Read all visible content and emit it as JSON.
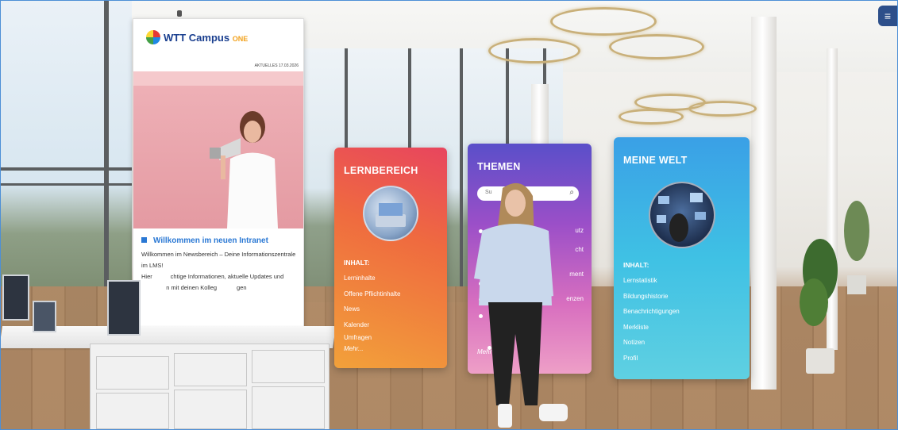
{
  "news_screen": {
    "logo_brand": "WTT Campus",
    "logo_suffix": "ONE",
    "meta": "AKTUELLES   17.03.2026",
    "title": "Willkommen im neuen Intranet",
    "body_lines": [
      "Willkommen im Newsbereich – Deine Informationszentrale",
      "im LMS!",
      "Hier           chtige Informationen, aktuelle Updates und",
      "               n mit deinen Kolleg            gen"
    ]
  },
  "panels": {
    "lernbereich": {
      "title": "LERNBEREICH",
      "content_label": "INHALT:",
      "items": [
        "Lerninhalte",
        "Offene Pflichtinhalte",
        "News",
        "Kalender",
        "Umfragen",
        "Mehr..."
      ]
    },
    "themen": {
      "title": "THEMEN",
      "search_placeholder": "Su            ngeben",
      "items": [
        "utz",
        "cht",
        "ment",
        "enzen",
        "Te          um"
      ],
      "more": "Mehr"
    },
    "meine_welt": {
      "title": "MEINE WELT",
      "content_label": "INHALT:",
      "items": [
        "Lernstatistik",
        "Bildungshistorie",
        "Benachrichtigungen",
        "Merkliste",
        "Notizen",
        "Profil"
      ]
    }
  },
  "menu_button": {
    "icon": "hamburger-menu-icon",
    "glyph": "≡"
  },
  "colors": {
    "lernbereich": "#ef6b3f",
    "themen": "#9b4fc8",
    "meine_welt": "#3fc1e4",
    "brand_blue": "#1a3f8f",
    "brand_orange": "#f2a11b"
  }
}
